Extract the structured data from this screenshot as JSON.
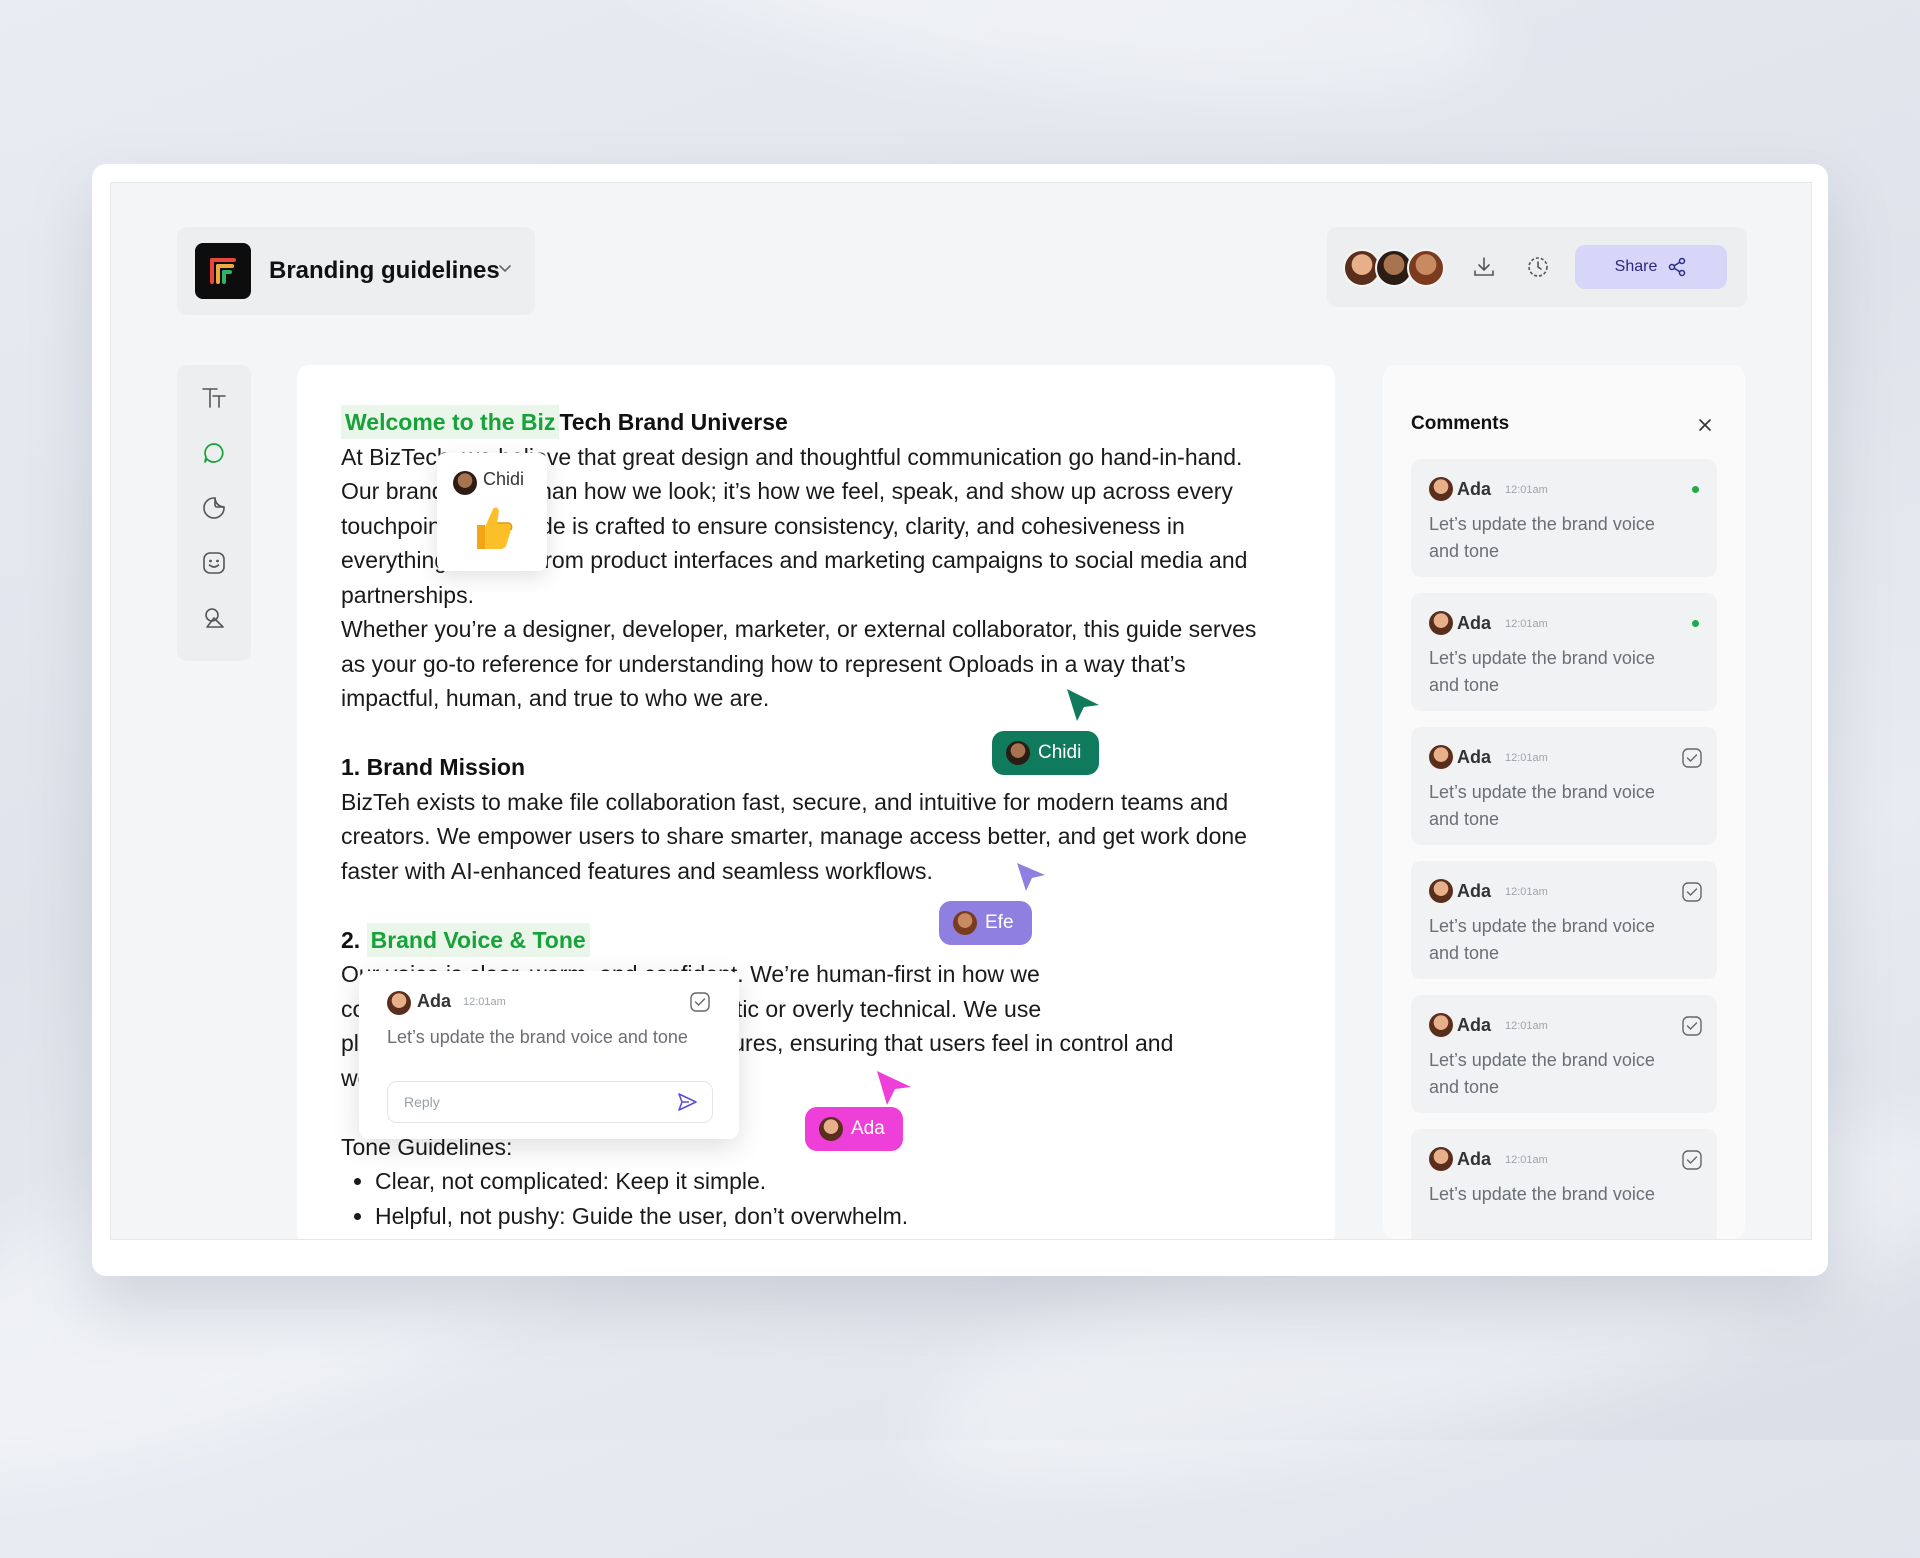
{
  "document": {
    "title": "Branding guidelines"
  },
  "header": {
    "share_label": "Share",
    "collaborators": [
      "Ada",
      "Chidi",
      "Efe"
    ]
  },
  "toolbar": {
    "tools": [
      "text-icon",
      "comment-icon",
      "sticker-icon",
      "emoji-icon",
      "shapes-icon"
    ]
  },
  "editor": {
    "heading_welcome_highlight": "Welcome to the Biz",
    "heading_welcome_rest": "Tech Brand Universe",
    "intro_lines": [
      "At BizTech, we believe that great design and thoughtful communication go hand-in-hand.",
      "Our brand is more than how we look; it’s how we feel, speak, and show up across every",
      "touchpoint. This guide is crafted to ensure consistency, clarity, and cohesiveness in",
      "everything we do—from product interfaces and marketing campaigns to social media and",
      "partnerships."
    ],
    "audience_lines": [
      "Whether you’re a designer, developer, marketer, or external collaborator, this guide serves",
      "as your go-to reference for understanding how to represent Oploads in a way that’s",
      "impactful, human, and true to who we are."
    ],
    "section1_title": "1. Brand Mission",
    "mission_lines": [
      "BizTeh exists to make file collaboration fast, secure, and intuitive for modern teams and",
      "creators. We empower users to share smarter, manage access better, and get work done",
      "faster with AI-enhanced features and seamless workflows."
    ],
    "section2_number": "2. ",
    "section2_title": "Brand Voice & Tone",
    "voice_lines": [
      "Our voice is clear, warm, and confident. We’re human-first in how we",
      "communicate—empathetic, never robotic or overly technical. We use",
      "plain language to explain complex features, ensuring that users feel in control and",
      "well supported."
    ],
    "tone_title": "Tone Guidelines:",
    "tone_bullets": [
      "Clear, not complicated: Keep it simple.",
      "Helpful, not pushy: Guide the user, don’t overwhelm."
    ]
  },
  "reaction": {
    "user": "Chidi",
    "emoji": "thumbs-up"
  },
  "cursors": [
    {
      "name": "Chidi",
      "color": "#0f7a5c"
    },
    {
      "name": "Efe",
      "color": "#8f7fe0"
    },
    {
      "name": "Ada",
      "color": "#ee3fd8"
    }
  ],
  "inline_comment": {
    "author": "Ada",
    "time": "12:01am",
    "text": "Let’s update the brand voice and tone",
    "reply_placeholder": "Reply"
  },
  "comments_panel": {
    "title": "Comments",
    "items": [
      {
        "author": "Ada",
        "time": "12:01am",
        "text": "Let’s update the brand voice and tone",
        "status": "unread"
      },
      {
        "author": "Ada",
        "time": "12:01am",
        "text": "Let’s update the brand voice and tone",
        "status": "unread"
      },
      {
        "author": "Ada",
        "time": "12:01am",
        "text": "Let’s update the brand voice and tone",
        "status": "resolved"
      },
      {
        "author": "Ada",
        "time": "12:01am",
        "text": "Let’s update the brand voice and tone",
        "status": "resolved"
      },
      {
        "author": "Ada",
        "time": "12:01am",
        "text": "Let’s update the brand voice and tone",
        "status": "resolved"
      },
      {
        "author": "Ada",
        "time": "12:01am",
        "text": "Let’s update the brand voice",
        "status": "resolved"
      }
    ]
  },
  "colors": {
    "accent_green": "#17a23a",
    "share_bg": "#d8d6f8",
    "chidi_cursor": "#0f7a5c",
    "efe_cursor": "#8f7fe0",
    "ada_cursor": "#ee3fd8"
  }
}
